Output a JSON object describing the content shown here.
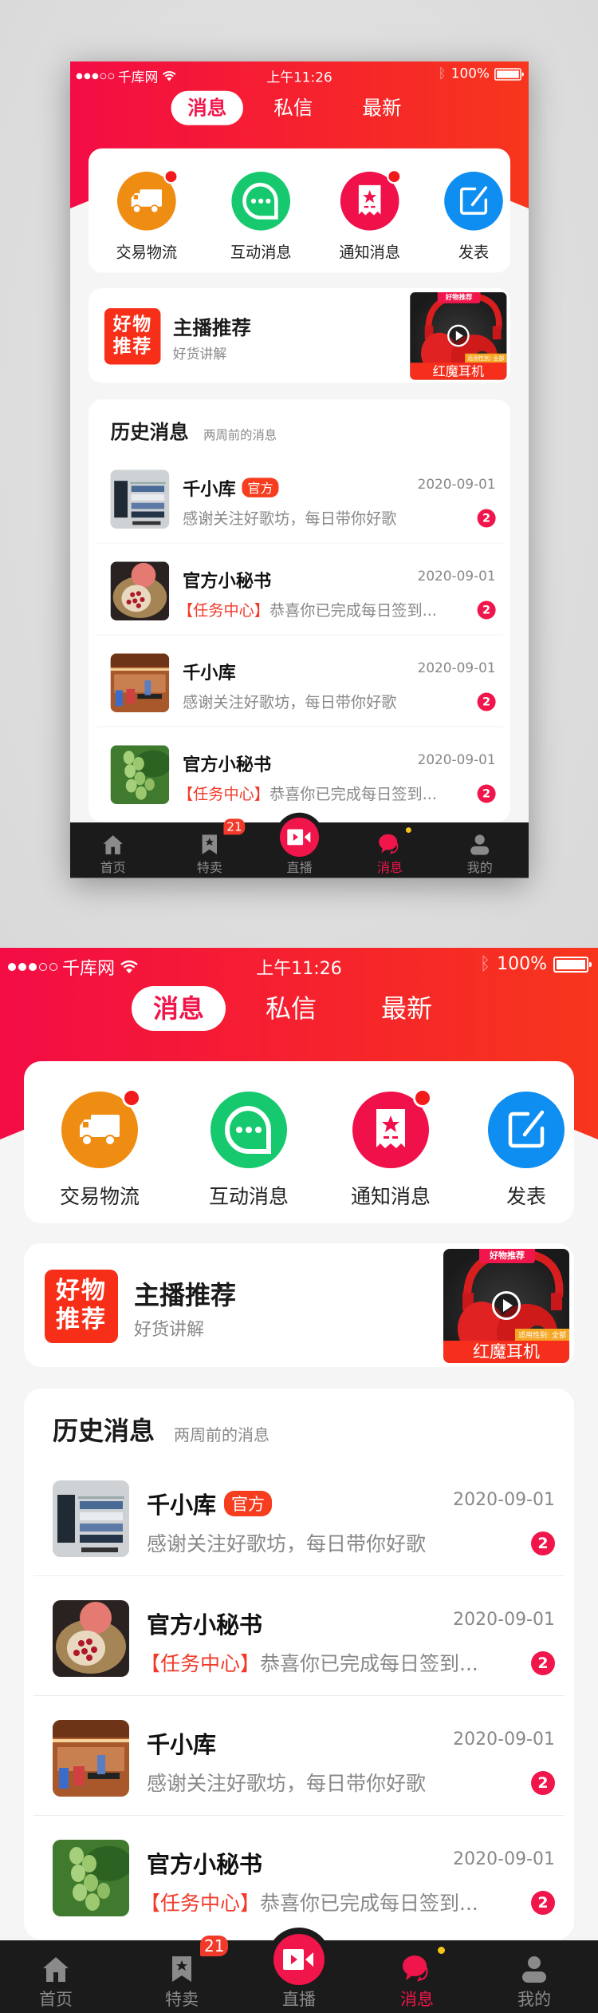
{
  "status_bar": {
    "carrier": "千库网",
    "time": "上午11:26",
    "battery": "100%"
  },
  "top_tabs": [
    {
      "label": "消息",
      "active": true
    },
    {
      "label": "私信",
      "active": false
    },
    {
      "label": "最新",
      "active": false
    }
  ],
  "shortcuts": [
    {
      "label": "交易物流",
      "icon": "truck-icon",
      "color": "#ef8c12",
      "has_dot": true
    },
    {
      "label": "互动消息",
      "icon": "chat-bubble-icon",
      "color": "#16c96e",
      "has_dot": false
    },
    {
      "label": "通知消息",
      "icon": "star-ticket-icon",
      "color": "#f0104a",
      "has_dot": true
    },
    {
      "label": "发表",
      "icon": "edit-icon",
      "color": "#0e8ef0",
      "has_dot": false
    }
  ],
  "recommend": {
    "logo_line1": "好物",
    "logo_line2": "推荐",
    "title": "主播推荐",
    "subtitle": "好货讲解",
    "thumb_tag": "好物推荐",
    "thumb_subtag": "适用性别: 全部",
    "thumb_caption": "红魔耳机"
  },
  "history": {
    "title": "历史消息",
    "subtitle": "两周前的消息",
    "messages": [
      {
        "name": "千小库",
        "badge": "官方",
        "date": "2020-09-01",
        "highlight": "",
        "text": "感谢关注好歌坊，每日带你好歌",
        "unread": "2",
        "thumb": "clothing-store"
      },
      {
        "name": "官方小秘书",
        "badge": "",
        "date": "2020-09-01",
        "highlight": "【任务中心】",
        "text": "恭喜你已完成每日签到...",
        "unread": "2",
        "thumb": "pomegranate"
      },
      {
        "name": "千小库",
        "badge": "",
        "date": "2020-09-01",
        "highlight": "",
        "text": "感谢关注好歌坊，每日带你好歌",
        "unread": "2",
        "thumb": "shop-interior"
      },
      {
        "name": "官方小秘书",
        "badge": "",
        "date": "2020-09-01",
        "highlight": "【任务中心】",
        "text": "恭喜你已完成每日签到...",
        "unread": "2",
        "thumb": "green-fruit"
      }
    ]
  },
  "tabbar": {
    "items": [
      {
        "label": "首页",
        "icon": "home-icon",
        "active": false
      },
      {
        "label": "特卖",
        "icon": "bookmark-star-icon",
        "active": false,
        "badge": "21"
      },
      {
        "label": "直播",
        "icon": "video-camera-icon",
        "active": false
      },
      {
        "label": "消息",
        "icon": "message-bubbles-icon",
        "active": true
      },
      {
        "label": "我的",
        "icon": "user-icon",
        "active": false
      }
    ]
  },
  "colors": {
    "brand": "#f0154a",
    "header_gradient_start": "#f30c45",
    "header_gradient_end": "#f7361d"
  }
}
